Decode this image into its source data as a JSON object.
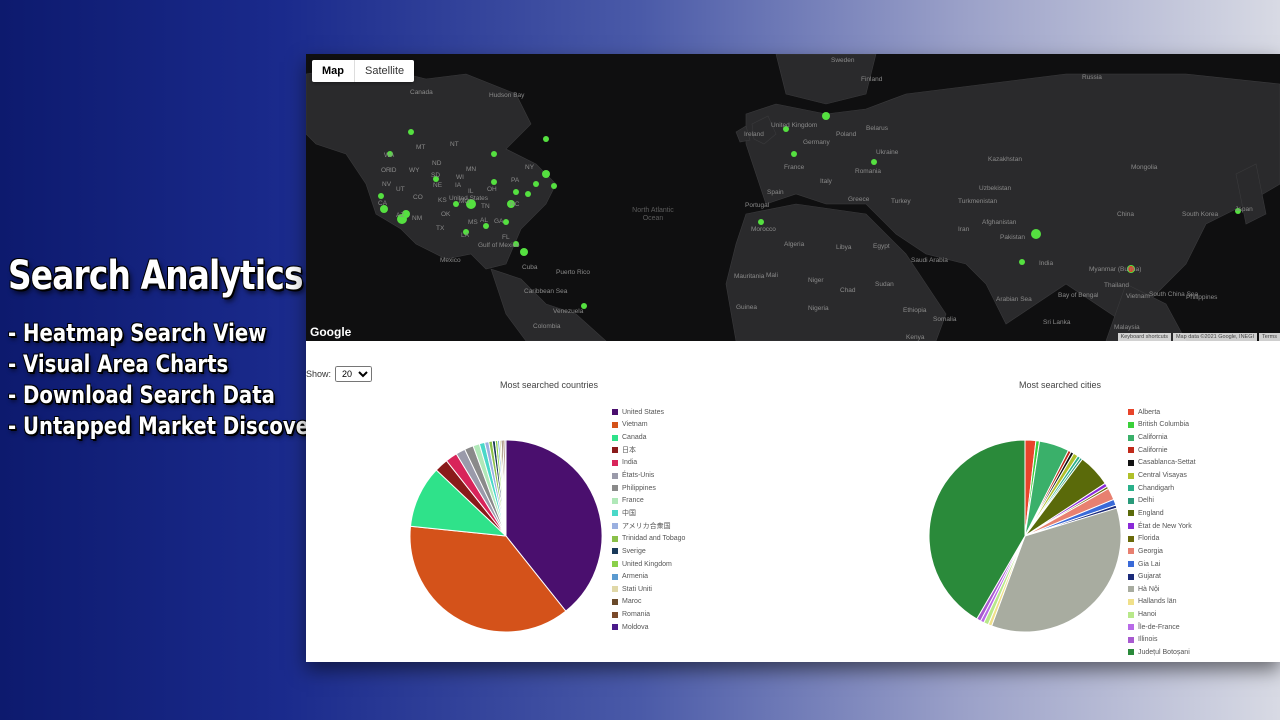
{
  "promo": {
    "title": "Search Analytics",
    "features": [
      "- Heatmap Search View",
      "- Visual Area Charts",
      "- Download Search Data",
      "- Untapped Market Discovery"
    ]
  },
  "map": {
    "type_buttons": [
      "Map",
      "Satellite"
    ],
    "labels": [
      "Sweden",
      "Finland",
      "Russia",
      "Canada",
      "Hudson Bay",
      "Ireland",
      "United Kingdom",
      "Poland",
      "Belarus",
      "Germany",
      "Ukraine",
      "Kazakhstan",
      "France",
      "Italy",
      "Romania",
      "Mongolia",
      "Uzbekistan",
      "Spain",
      "Portugal",
      "Greece",
      "Turkey",
      "Turkmenistan",
      "United States",
      "China",
      "South Korea",
      "Japan",
      "Morocco",
      "Algeria",
      "Libya",
      "Egypt",
      "Iran",
      "Afghanistan",
      "Pakistan",
      "Mexico",
      "Cuba",
      "Puerto Rico",
      "Saudi Arabia",
      "Mauritania",
      "Mali",
      "Niger",
      "Chad",
      "Sudan",
      "India",
      "Myanmar (Burma)",
      "Thailand",
      "Vietnam",
      "Philippines",
      "Venezuela",
      "Colombia",
      "Caribbean Sea",
      "Gulf of Mexico",
      "Ethiopia",
      "Nigeria",
      "Bay of Bengal",
      "Arabian Sea",
      "South China Sea",
      "Malaysia",
      "Sri Lanka",
      "Kenya",
      "Somalia",
      "Guinea",
      "MT",
      "NT",
      "ND",
      "MN",
      "SD",
      "WI",
      "WY",
      "NE",
      "IA",
      "IL",
      "OH",
      "NY",
      "PA",
      "NV",
      "UT",
      "CO",
      "KS",
      "MO",
      "CA",
      "AZ",
      "NM",
      "OK",
      "TN",
      "NC",
      "TX",
      "MS",
      "AL",
      "GA",
      "LA",
      "FL",
      "OR",
      "ID",
      "WA"
    ],
    "ocean_label": "North Atlantic Ocean",
    "google": "Google",
    "attribution": [
      "Keyboard shortcuts",
      "Map data ©2021 Google, INEGI",
      "Terms"
    ]
  },
  "controls": {
    "show_label": "Show:",
    "show_value": "20"
  },
  "countries_chart": {
    "title": "Most searched countries",
    "chart_data": {
      "type": "pie",
      "labels": [
        "United States",
        "Vietnam",
        "Canada",
        "日本",
        "India",
        "États-Unis",
        "Philippines",
        "France",
        "中国",
        "アメリカ合衆国",
        "Trinidad and Tobago",
        "Sverige",
        "United Kingdom",
        "Armenia",
        "Stati Uniti",
        "Maroc",
        "Romania",
        "Moldova"
      ],
      "values": [
        39.5,
        37.5,
        10.5,
        2.3,
        2.0,
        1.6,
        1.5,
        1.1,
        0.9,
        0.7,
        0.6,
        0.5,
        0.4,
        0.3,
        0.3,
        0.3,
        0.3,
        0.2
      ],
      "colors": [
        "#4a0f6e",
        "#d4521a",
        "#2fe28a",
        "#8a1a1a",
        "#d8245a",
        "#9a9aaa",
        "#8a8a8a",
        "#b0e8b8",
        "#4ad8c8",
        "#9ab0e0",
        "#8ac04a",
        "#1a3a5a",
        "#8ad04a",
        "#5a9ad0",
        "#e0d8a8",
        "#6a4a2a",
        "#7a4a2a",
        "#4a1a8a"
      ]
    }
  },
  "cities_chart": {
    "title": "Most searched cities",
    "chart_data": {
      "type": "pie",
      "labels": [
        "Alberta",
        "British Columbia",
        "California",
        "Californie",
        "Casablanca-Settat",
        "Central Visayas",
        "Chandigarh",
        "Delhi",
        "England",
        "État de New York",
        "Florida",
        "Georgia",
        "Gia Lai",
        "Gujarat",
        "Hà Nội",
        "Hallands län",
        "Hanoi",
        "Île-de-France",
        "Illinois",
        "Județul Botoșani"
      ],
      "values": [
        1.8,
        0.6,
        5.0,
        0.5,
        0.5,
        0.8,
        0.5,
        0.4,
        5.5,
        0.6,
        0.4,
        2.0,
        1.0,
        0.5,
        35.0,
        0.6,
        0.8,
        0.6,
        0.7,
        41.2
      ],
      "colors": [
        "#e8442a",
        "#3ad03a",
        "#3ab06a",
        "#c02a1a",
        "#111111",
        "#b0c02a",
        "#2ab08a",
        "#2a9a7a",
        "#5a6a0a",
        "#8a2ad8",
        "#6a6a0a",
        "#e88070",
        "#3a6ad8",
        "#1a2a7a",
        "#a8aca0",
        "#f0e08a",
        "#b8e88a",
        "#b86ae8",
        "#a85ad0",
        "#2a8a3a"
      ]
    }
  }
}
